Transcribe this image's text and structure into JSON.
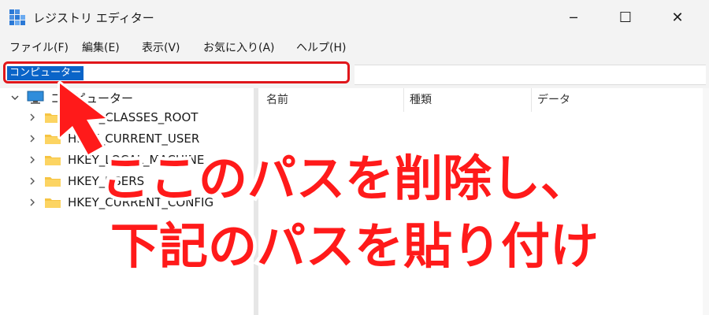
{
  "window": {
    "title": "レジストリ エディター",
    "controls": {
      "minimize": "─",
      "maximize": "☐",
      "close": "✕"
    }
  },
  "menu": [
    "ファイル(F)",
    "編集(E)",
    "表示(V)",
    "お気に入り(A)",
    "ヘルプ(H)"
  ],
  "address": {
    "value": "コンピューター"
  },
  "tree": {
    "root": "コンピューター",
    "items": [
      "HKEY_CLASSES_ROOT",
      "HKEY_CURRENT_USER",
      "HKEY_LOCAL_MACHINE",
      "HKEY_USERS",
      "HKEY_CURRENT_CONFIG"
    ]
  },
  "list": {
    "columns": [
      "名前",
      "種類",
      "データ"
    ]
  },
  "annotation": {
    "line1": "ここのパスを削除し、",
    "line2": "下記のパスを貼り付け",
    "color": "#ff1a1a",
    "outline_color": "#ffffff"
  },
  "icons": {
    "app": "registry-icon",
    "computer": "monitor-icon",
    "folder": "folder-icon",
    "chevron": "chevron-right-icon",
    "annotation": "arrow-pointer-icon"
  }
}
